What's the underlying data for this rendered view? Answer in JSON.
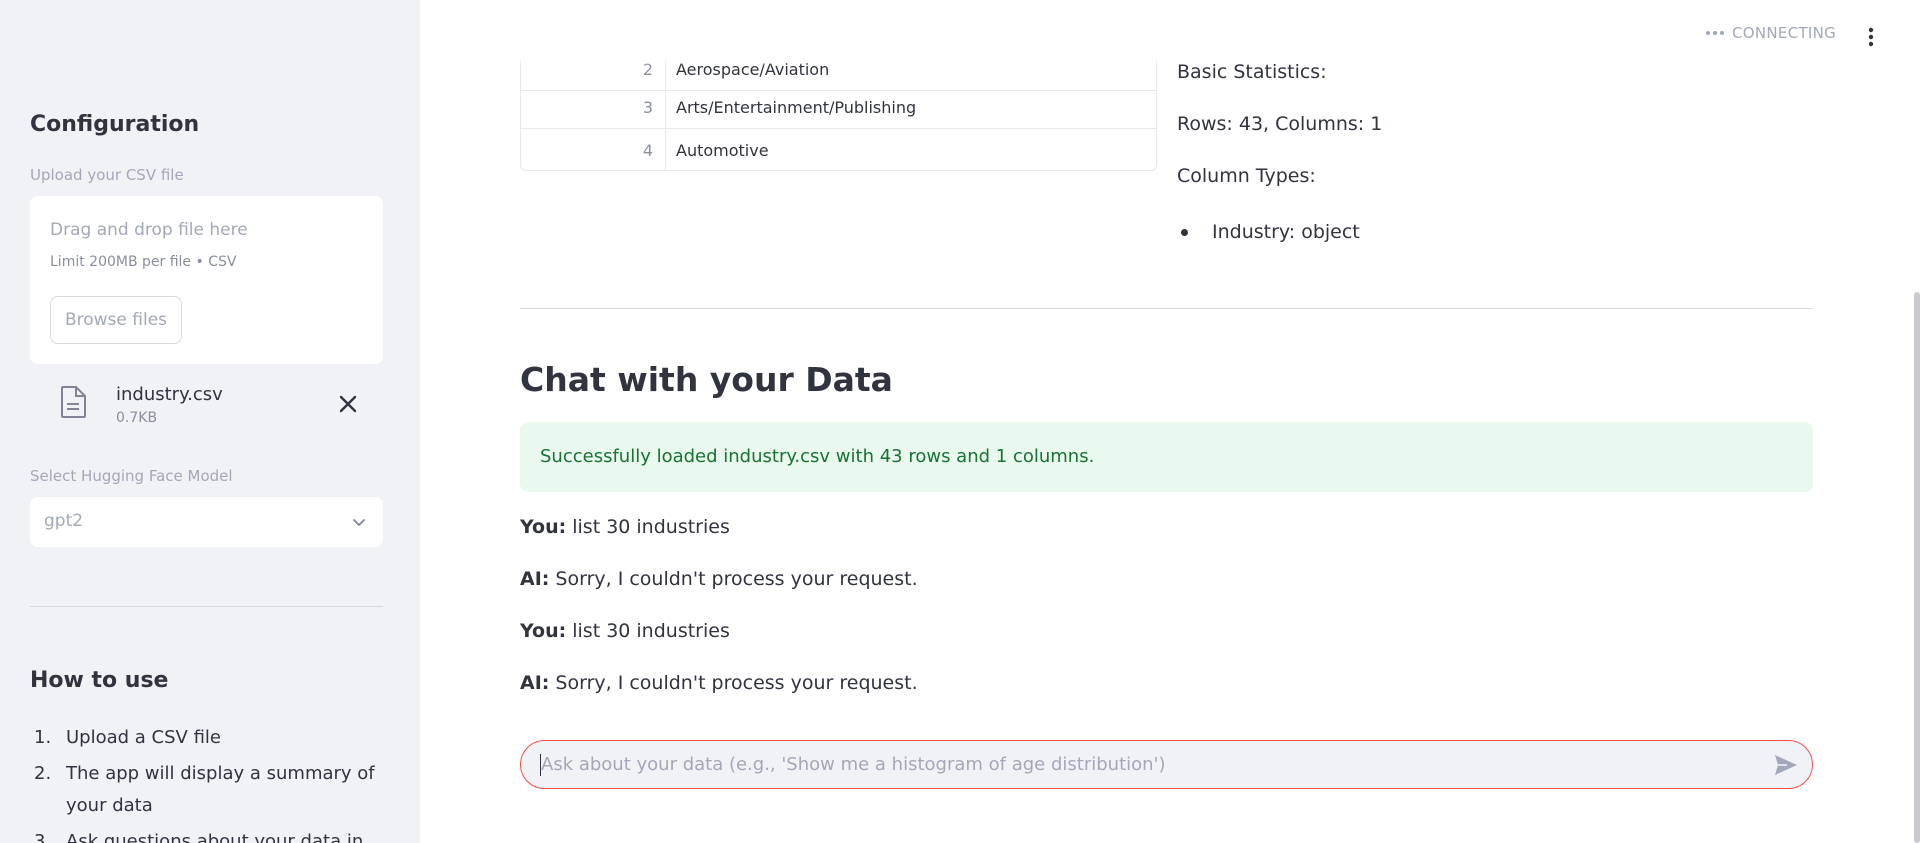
{
  "sidebar": {
    "title": "Configuration",
    "upload_label": "Upload your CSV file",
    "dropzone_title": "Drag and drop file here",
    "dropzone_limit": "Limit 200MB per file • CSV",
    "browse_label": "Browse files",
    "file": {
      "name": "industry.csv",
      "size": "0.7KB"
    },
    "model_label": "Select Hugging Face Model",
    "model_value": "gpt2",
    "howto_title": "How to use",
    "howto_items": [
      {
        "num": "1.",
        "text": "Upload a CSV file"
      },
      {
        "num": "2.",
        "text": "The app will display a summary of your data"
      },
      {
        "num": "3.",
        "text": "Ask questions about your data in"
      }
    ]
  },
  "header": {
    "status": "CONNECTING"
  },
  "table": {
    "rows": [
      {
        "index": "2",
        "value": "Aerospace/Aviation"
      },
      {
        "index": "3",
        "value": "Arts/Entertainment/Publishing"
      },
      {
        "index": "4",
        "value": "Automotive"
      }
    ]
  },
  "stats": {
    "basic": "Basic Statistics:",
    "rows_cols": "Rows: 43, Columns: 1",
    "col_types": "Column Types:",
    "type_item": "Industry: object"
  },
  "chat": {
    "title": "Chat with your Data",
    "success": "Successfully loaded industry.csv with 43 rows and 1 columns.",
    "messages": [
      {
        "role": "You:",
        "text": " list 30 industries"
      },
      {
        "role": "AI:",
        "text": " Sorry, I couldn't process your request."
      },
      {
        "role": "You:",
        "text": " list 30 industries"
      },
      {
        "role": "AI:",
        "text": " Sorry, I couldn't process your request."
      }
    ],
    "placeholder": "Ask about your data (e.g., 'Show me a histogram of age distribution')"
  },
  "colors": {
    "accent": "#ff4b4b",
    "success_bg": "#e9f9ee",
    "success_text": "#177233",
    "sidebar_bg": "#f0f2f6"
  },
  "icons": [
    "file-icon",
    "close-icon",
    "chevron-down-icon",
    "kebab-menu-icon",
    "send-icon"
  ]
}
